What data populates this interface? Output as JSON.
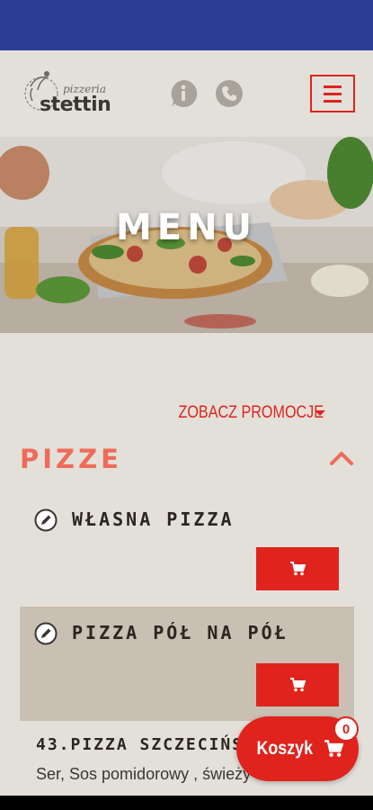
{
  "header": {
    "logo_small": "pizzeria",
    "logo_big": "stettin",
    "icons": [
      "info-icon",
      "phone-icon",
      "hamburger-menu-icon"
    ]
  },
  "hero": {
    "title": "MENU"
  },
  "promo": {
    "label": "ZOBACZ PROMOCJE"
  },
  "category": {
    "title": "PIZZE",
    "state_icon": "chevron-up-icon"
  },
  "items": [
    {
      "name": "WŁASNA PIZZA",
      "icon": "edit-icon",
      "cart_icon": "cart-icon"
    },
    {
      "name": "PIZZA PÓŁ NA PÓŁ",
      "icon": "edit-icon",
      "cart_icon": "cart-icon"
    }
  ],
  "product": {
    "name": "43.PIZZA SZCZECIŃS",
    "description": "Ser, Sos pomidorowy , świeży"
  },
  "cart": {
    "label": "Koszyk",
    "count": "0"
  },
  "colors": {
    "accent": "#e0231c",
    "status_bar": "#2d3c96",
    "category": "#ef6b59",
    "background": "#e3e0da"
  }
}
